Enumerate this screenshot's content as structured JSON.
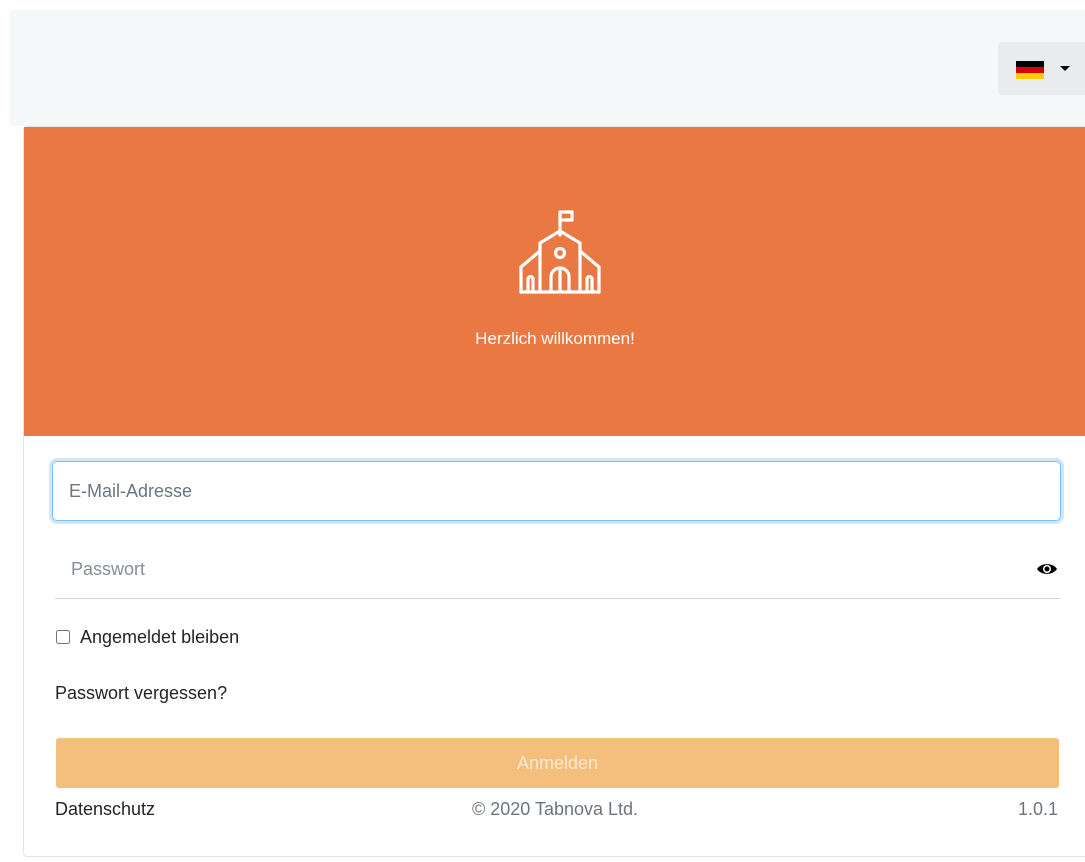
{
  "language_selector": {
    "flag_colors": [
      "#000000",
      "#dd0000",
      "#ffce00"
    ],
    "icon": "germany-flag-icon"
  },
  "header": {
    "icon": "school-building-icon",
    "welcome_text": "Herzlich willkommen!",
    "background_color": "#ea7842"
  },
  "form": {
    "email_placeholder": "E-Mail-Adresse",
    "email_value": "",
    "password_placeholder": "Passwort",
    "password_value": "",
    "password_toggle_icon": "eye-icon",
    "remember_label": "Angemeldet bleiben",
    "remember_checked": false,
    "forgot_label": "Passwort vergessen?",
    "submit_label": "Anmelden",
    "submit_color": "#f4be7d"
  },
  "footer": {
    "privacy_label": "Datenschutz",
    "copyright": "© 2020 Tabnova Ltd.",
    "version": "1.0.1"
  }
}
